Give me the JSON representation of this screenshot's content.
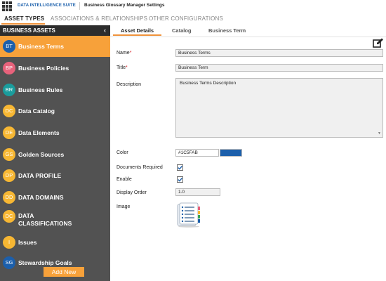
{
  "app": {
    "suite_name": "DATA INTELLIGENCE SUITE",
    "title": "Business Glossary Manager Settings"
  },
  "main_tabs": [
    {
      "label": "ASSET TYPES",
      "active": true
    },
    {
      "label": "ASSOCIATIONS & RELATIONSHIPS",
      "active": false
    },
    {
      "label": "OTHER CONFIGURATIONS",
      "active": false
    }
  ],
  "sidebar": {
    "header": "BUSINESS ASSETS",
    "collapse_icon": "chevron-left-icon",
    "items": [
      {
        "abbr": "BT",
        "label": "Business Terms",
        "color": "#1c5fab",
        "active": true
      },
      {
        "abbr": "BP",
        "label": "Business Policies",
        "color": "#e8627b",
        "active": false
      },
      {
        "abbr": "BR",
        "label": "Business Rules",
        "color": "#1a9c9c",
        "active": false
      },
      {
        "abbr": "DC",
        "label": "Data Catalog",
        "color": "#f7b733",
        "active": false
      },
      {
        "abbr": "DE",
        "label": "Data Elements",
        "color": "#f7b733",
        "active": false
      },
      {
        "abbr": "GS",
        "label": "Golden Sources",
        "color": "#f7b733",
        "active": false
      },
      {
        "abbr": "DP",
        "label": "DATA PROFILE",
        "color": "#f7b733",
        "active": false
      },
      {
        "abbr": "DD",
        "label": "DATA DOMAINS",
        "color": "#f7b733",
        "active": false
      },
      {
        "abbr": "DC",
        "label": "DATA CLASSIFICATIONS",
        "color": "#f7b733",
        "active": false
      },
      {
        "abbr": "I",
        "label": "Issues",
        "color": "#f7b733",
        "active": false
      },
      {
        "abbr": "SG",
        "label": "Stewardship Goals",
        "color": "#1c5fab",
        "active": false
      }
    ],
    "add_new_label": "Add New"
  },
  "sub_tabs": [
    {
      "label": "Asset Details",
      "active": true
    },
    {
      "label": "Catalog",
      "active": false
    },
    {
      "label": "Business Term",
      "active": false
    }
  ],
  "form": {
    "name_label": "Name",
    "name_value": "Business Terms",
    "title_label": "Title",
    "title_value": "Business Term",
    "description_label": "Description",
    "description_value": "Business Terms Description",
    "color_label": "Color",
    "color_value": "#1C5FAB",
    "documents_required_label": "Documents Required",
    "documents_required": true,
    "enable_label": "Enable",
    "enable": true,
    "display_order_label": "Display Order",
    "display_order_value": "1.0",
    "image_label": "Image",
    "required_marker": "*"
  },
  "colors": {
    "accent": "#f7a13a",
    "sidebar_bg": "#525252",
    "sidebar_header_bg": "#2d2d2d",
    "brand_blue": "#1c5fab"
  }
}
